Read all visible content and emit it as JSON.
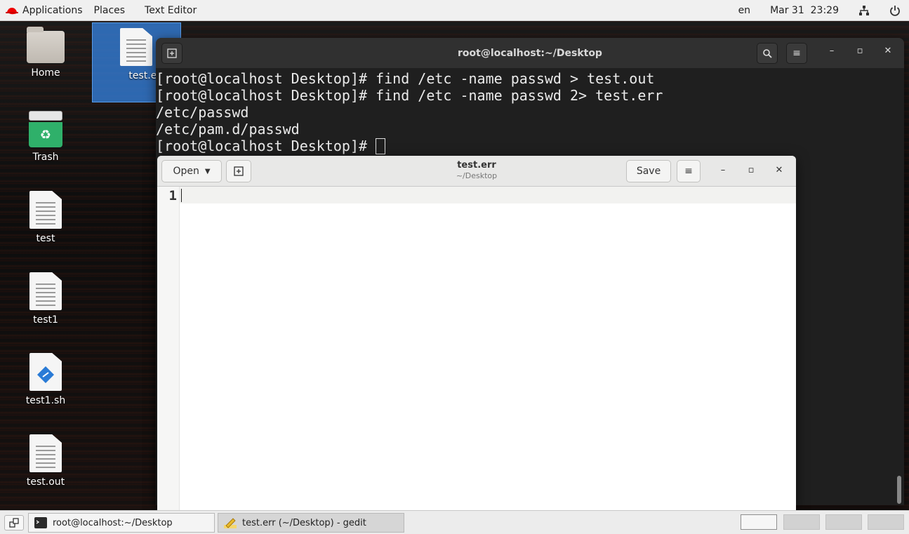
{
  "topbar": {
    "applications": "Applications",
    "places": "Places",
    "active_app": "Text Editor",
    "lang": "en",
    "datetime": "Mar 31  23:29",
    "icons": [
      "redhat-icon",
      "network-icon",
      "power-icon"
    ]
  },
  "desktop": {
    "icons": [
      {
        "label": "Home",
        "type": "folder"
      },
      {
        "label": "test.err",
        "type": "document",
        "selected": true
      },
      {
        "label": "Trash",
        "type": "trash"
      },
      {
        "label": "test",
        "type": "document"
      },
      {
        "label": "test1",
        "type": "document"
      },
      {
        "label": "test1.sh",
        "type": "script"
      },
      {
        "label": "test.out",
        "type": "document"
      }
    ]
  },
  "terminal": {
    "title": "root@localhost:~/Desktop",
    "lines": [
      "[root@localhost Desktop]# find /etc -name passwd > test.out",
      "[root@localhost Desktop]# find /etc -name passwd 2> test.err",
      "/etc/passwd",
      "/etc/pam.d/passwd",
      "[root@localhost Desktop]# "
    ],
    "buttons": [
      "new-tab-icon",
      "search-icon",
      "menu-icon",
      "minimize-icon",
      "maximize-icon",
      "close-icon"
    ]
  },
  "gedit": {
    "open_label": "Open",
    "save_label": "Save",
    "filename": "test.err",
    "path": "~/Desktop",
    "line_number": "1",
    "content": ""
  },
  "taskbar": {
    "tasks": [
      {
        "label": "root@localhost:~/Desktop",
        "icon": "terminal-icon",
        "active": false
      },
      {
        "label": "test.err (~/Desktop) - gedit",
        "icon": "gedit-icon",
        "active": true
      }
    ],
    "workspaces": 4,
    "current_workspace": 1
  }
}
